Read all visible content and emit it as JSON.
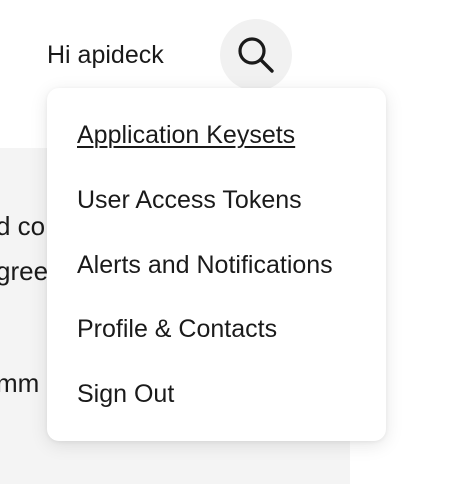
{
  "header": {
    "greeting": "Hi apideck",
    "search_icon": "search-icon"
  },
  "background": {
    "line_1": "d co",
    "line_2": "gree",
    "line_3": "mm"
  },
  "menu": {
    "items": [
      {
        "label": "Application Keysets",
        "active": true
      },
      {
        "label": "User Access Tokens",
        "active": false
      },
      {
        "label": "Alerts and Notifications",
        "active": false
      },
      {
        "label": "Profile & Contacts",
        "active": false
      },
      {
        "label": "Sign Out",
        "active": false
      }
    ]
  },
  "colors": {
    "text": "#1a1a1a",
    "panel_bg": "#f4f4f4",
    "search_bg": "#f1f1f1",
    "dropdown_bg": "#ffffff"
  }
}
